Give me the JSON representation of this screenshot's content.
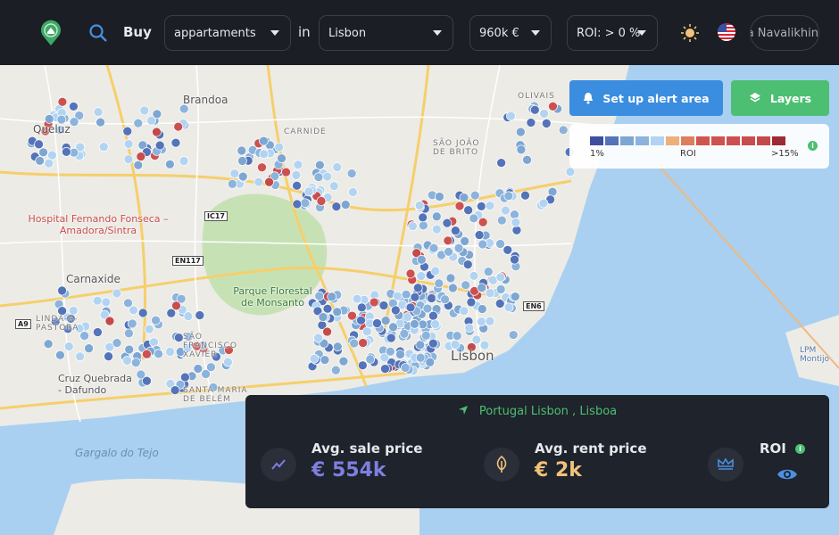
{
  "header": {
    "buy_label": "Buy",
    "property_type": "appartaments",
    "in_label": "in",
    "city": "Lisbon",
    "price": "960k €",
    "roi": "ROI: > 0 %",
    "user_name": "Nikita Navalikhin",
    "icons": [
      "location-logo-icon",
      "search-icon",
      "sun-icon",
      "us-flag-icon"
    ]
  },
  "map": {
    "labels": {
      "queluz": "Queluz",
      "brandoa": "Brandoa",
      "hospital": "Hospital Fernando Fonseca – Amadora/Sintra",
      "carnaxide": "Carnaxide",
      "monsanto": "Parque Florestal de Monsanto",
      "lisbon": "Lisbon",
      "gargalo": "Gargalo do Tejo",
      "sao_joao": "SÃO JOÃO DE BRITO",
      "carnide": "CARNIDE",
      "olivais": "OLIVAIS",
      "linda": "LINDA-A-PASTORA",
      "sao_francisco": "SÃO FRANCISCO XAVIER",
      "cruz": "Cruz Quebrada - Dafundo",
      "belem": "SANTA MARIA DE BELÉM",
      "montijo": "LPM Montijo",
      "ic17": "IC17",
      "en117": "EN117",
      "en6": "EN6",
      "a9": "A9"
    }
  },
  "controls": {
    "alert_button": "Set up alert area",
    "layers_button": "Layers"
  },
  "legend": {
    "min_label": "1%",
    "title": "ROI",
    "max_label": ">15%",
    "colors": [
      "#3d4f9e",
      "#5473b8",
      "#7ea6d2",
      "#8bb3db",
      "#b2d4f2",
      "#eeb07a",
      "#dd7f5f",
      "#cf5550",
      "#cd5250",
      "#cc5050",
      "#c84d4d",
      "#c44a4a",
      "#9e2a35"
    ]
  },
  "summary": {
    "location": "Portugal Lisbon , Lisboa",
    "sale_title": "Avg. sale price",
    "sale_value": "€ 554k",
    "rent_title": "Avg. rent price",
    "rent_value": "€ 2k",
    "roi_title": "ROI",
    "colors": {
      "sale": "#7f7fe0",
      "rent": "#f0c27a",
      "accent": "#4dbf73"
    }
  }
}
